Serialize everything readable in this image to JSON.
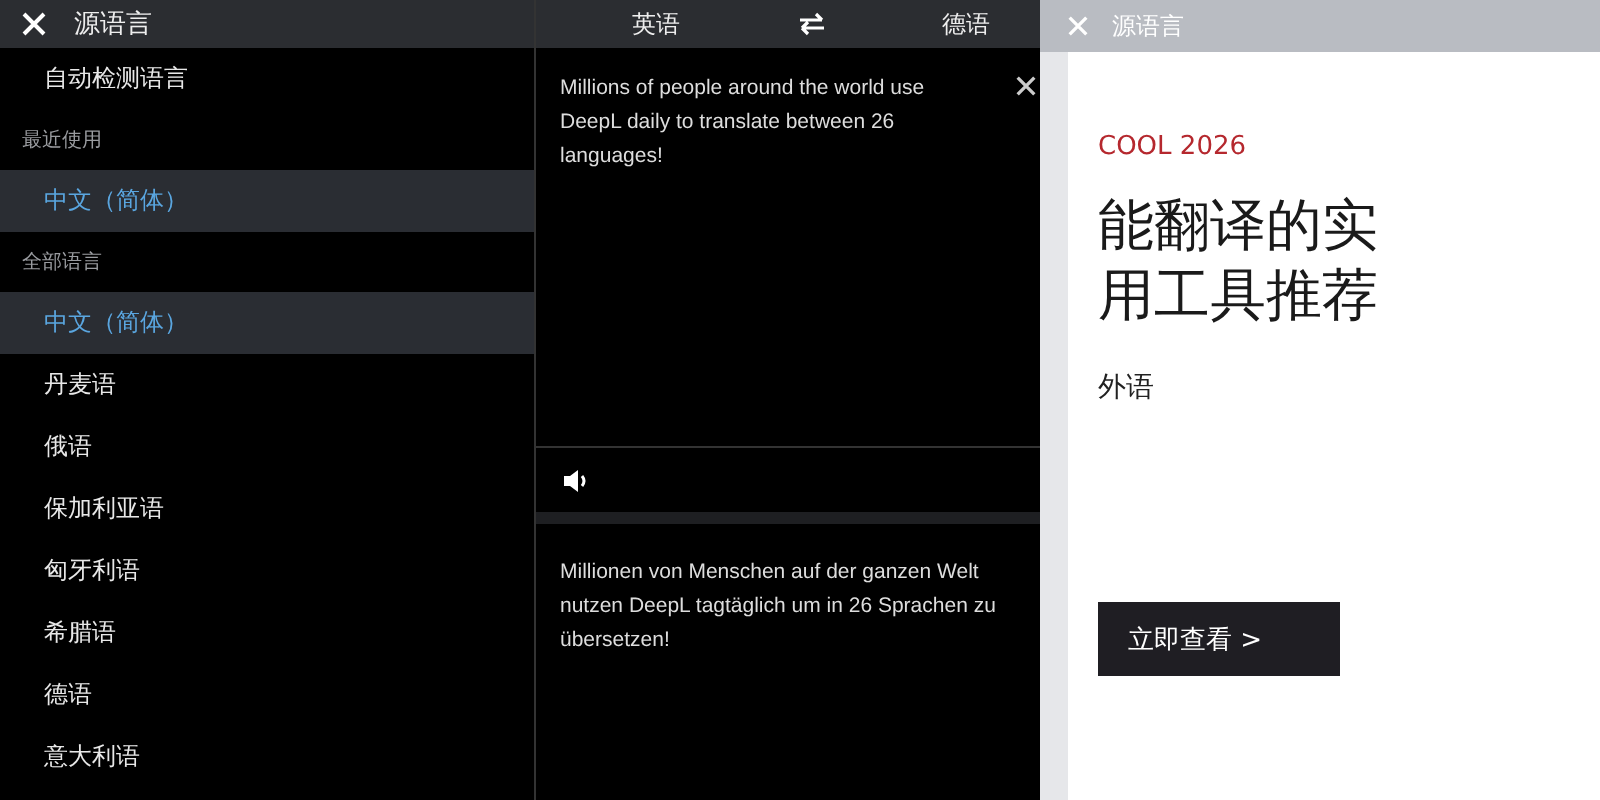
{
  "language_panel": {
    "title": "源语言",
    "items": [
      {
        "kind": "option",
        "label": "自动检测语言",
        "selected": false
      },
      {
        "kind": "section",
        "label": "最近使用"
      },
      {
        "kind": "option",
        "label": "中文（简体）",
        "selected": true
      },
      {
        "kind": "section",
        "label": "全部语言"
      },
      {
        "kind": "option",
        "label": "中文（简体）",
        "selected": true
      },
      {
        "kind": "option",
        "label": "丹麦语",
        "selected": false
      },
      {
        "kind": "option",
        "label": "俄语",
        "selected": false
      },
      {
        "kind": "option",
        "label": "保加利亚语",
        "selected": false
      },
      {
        "kind": "option",
        "label": "匈牙利语",
        "selected": false
      },
      {
        "kind": "option",
        "label": "希腊语",
        "selected": false
      },
      {
        "kind": "option",
        "label": "德语",
        "selected": false
      },
      {
        "kind": "option",
        "label": "意大利语",
        "selected": false
      }
    ]
  },
  "translator": {
    "source_language": "英语",
    "target_language": "德语",
    "source_text": "Millions of people around the world use DeepL daily to translate between 26 languages!",
    "target_text": "Millionen von Menschen auf der ganzen Welt nutzen DeepL tagtäglich um in 26 Sprachen zu übersetzen!"
  },
  "promo": {
    "faded_header_title": "源语言",
    "eyebrow": "COOL 2026",
    "headline_lines": [
      "能翻译的实",
      "用工具推荐"
    ],
    "category": "外语",
    "cta": "立即查看 >"
  }
}
